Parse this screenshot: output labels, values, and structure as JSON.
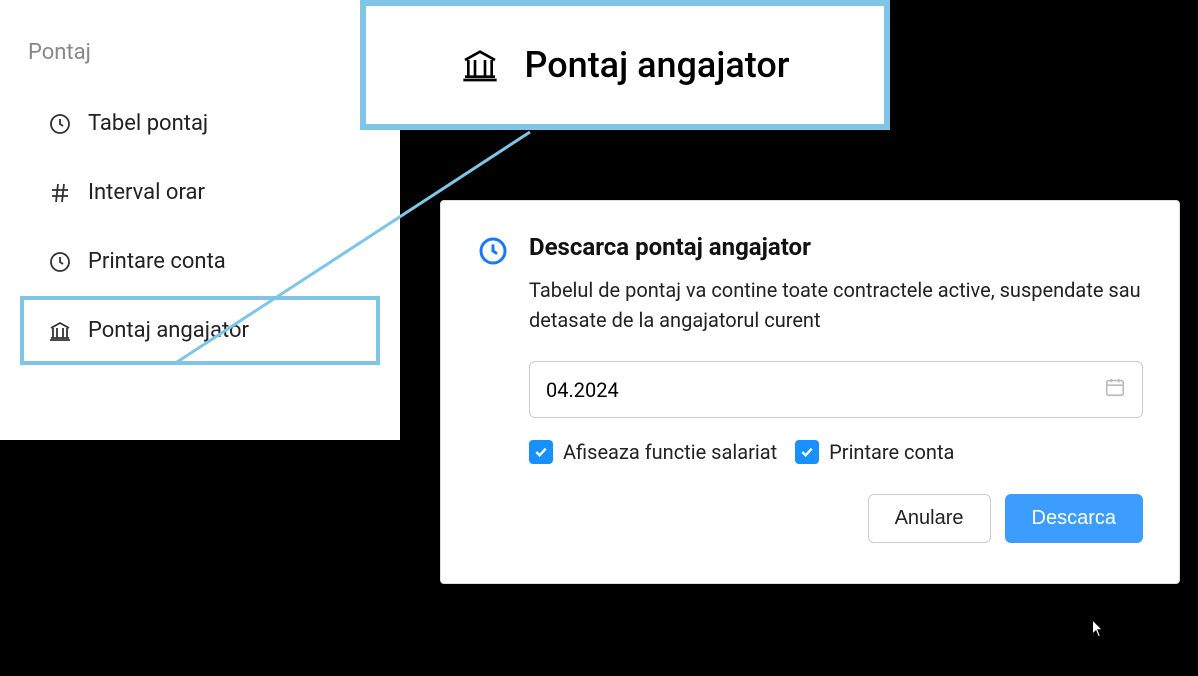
{
  "sidebar": {
    "title": "Pontaj",
    "items": [
      {
        "label": "Tabel pontaj",
        "icon": "clock-history-icon"
      },
      {
        "label": "Interval orar",
        "icon": "hash-icon"
      },
      {
        "label": "Printare conta",
        "icon": "clock-icon"
      },
      {
        "label": "Pontaj angajator",
        "icon": "bank-icon"
      }
    ]
  },
  "callout": {
    "title": "Pontaj angajator"
  },
  "modal": {
    "title": "Descarca pontaj angajator",
    "description": "Tabelul de pontaj va contine toate contractele active, suspendate sau detasate de la angajatorul curent",
    "date_value": "04.2024",
    "checkbox1_label": "Afiseaza functie salariat",
    "checkbox2_label": "Printare conta",
    "cancel_label": "Anulare",
    "confirm_label": "Descarca"
  }
}
